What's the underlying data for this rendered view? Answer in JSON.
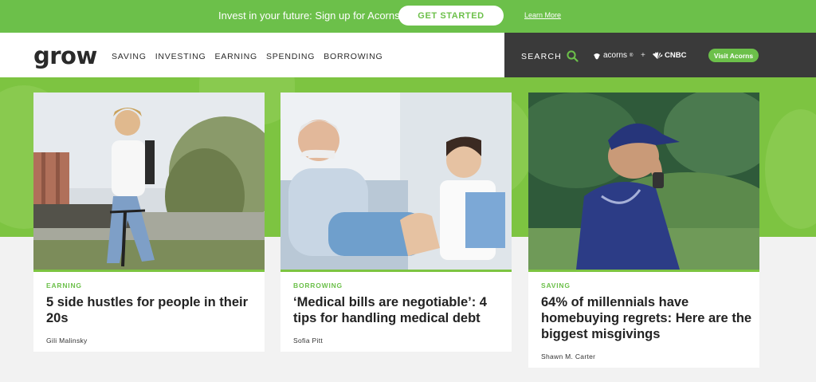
{
  "promo": {
    "text": "Invest in your future: Sign up for Acorns",
    "cta": "GET STARTED",
    "link": "Learn More"
  },
  "header": {
    "logo": "grow",
    "nav": [
      "SAVING",
      "INVESTING",
      "EARNING",
      "SPENDING",
      "BORROWING"
    ],
    "search_label": "SEARCH",
    "partner_acorns": "acorns",
    "plus": "+",
    "partner_cnbc": "CNBC",
    "visit_button": "Visit Acorns"
  },
  "cards": [
    {
      "category": "EARNING",
      "title": "5 side hustles for people in their 20s",
      "author": "Gili Malinsky"
    },
    {
      "category": "BORROWING",
      "title": "‘Medical bills are negotiable’: 4 tips for handling medical debt",
      "author": "Sofia Pitt"
    },
    {
      "category": "SAVING",
      "title": "64% of millennials have homebuying regrets: Here are the biggest misgivings",
      "author": "Shawn M. Carter"
    }
  ],
  "colors": {
    "brand_green": "#6cc04a",
    "hero_green": "#7dc441",
    "dark_header": "#3a3a3a"
  }
}
